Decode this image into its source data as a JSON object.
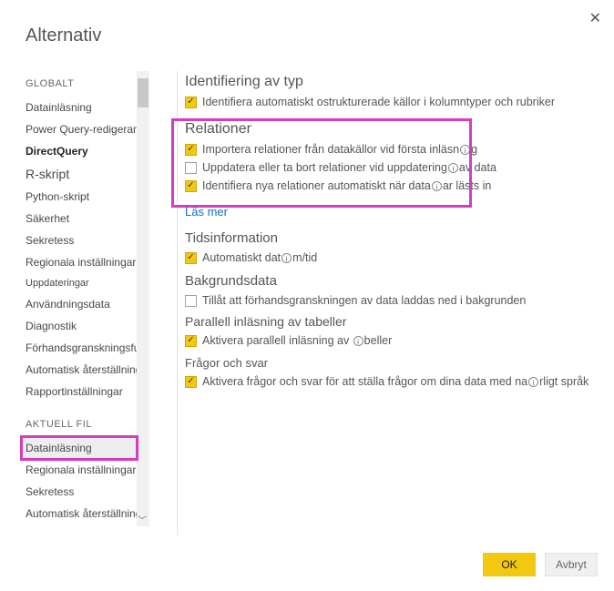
{
  "window": {
    "title": "Alternativ"
  },
  "sidebar": {
    "globalHead": "GLOBALT",
    "globalItems": [
      "Datainläsning",
      "Power Query-redigeraren",
      "DirectQuery",
      "R-skript",
      "Python-skript",
      "Säkerhet",
      "Sekretess",
      "Regionala inställningar",
      "Uppdateringar",
      "Användningsdata",
      "Diagnostik",
      "Förhandsgranskningsfunktioner",
      "Automatisk återställning",
      "Rapportinställningar"
    ],
    "currentHead": "AKTUELL FIL",
    "currentItems": [
      "Datainläsning",
      "Regionala inställningar",
      "Sekretess",
      "Automatisk återställning"
    ]
  },
  "main": {
    "typeDetection": {
      "title": "Identifiering av typ",
      "cb1": "Identifiera automatiskt ostrukturerade källor i kolumntyper och rubriker"
    },
    "relations": {
      "title": "Relationer",
      "cb1a": "Importera relationer från datakällor vid första inläsn",
      "cb1b": "g",
      "cb2a": "Uppdatera eller ta bort relationer vid uppdatering",
      "cb2b": "av data",
      "cb3a": "Identifiera nya relationer automatiskt när data",
      "cb3b": "ar lästs in",
      "link": "Läs mer"
    },
    "time": {
      "title": "Tidsinformation",
      "cb1a": "Automatiskt dat",
      "cb1b": "m/tid"
    },
    "bg": {
      "title": "Bakgrundsdata",
      "cb1": "Tillåt att förhandsgranskningen av data laddas ned i bakgrunden"
    },
    "parallel": {
      "title": "Parallell inläsning av tabeller",
      "cb1a": "Aktivera parallell inläsning av ",
      "cb1b": "beller"
    },
    "qna": {
      "title": "Frågor och svar",
      "cb1a": "Aktivera frågor och svar för att ställa frågor om dina data med na",
      "cb1b": "rligt språk"
    }
  },
  "buttons": {
    "ok": "OK",
    "cancel": "Avbryt"
  }
}
